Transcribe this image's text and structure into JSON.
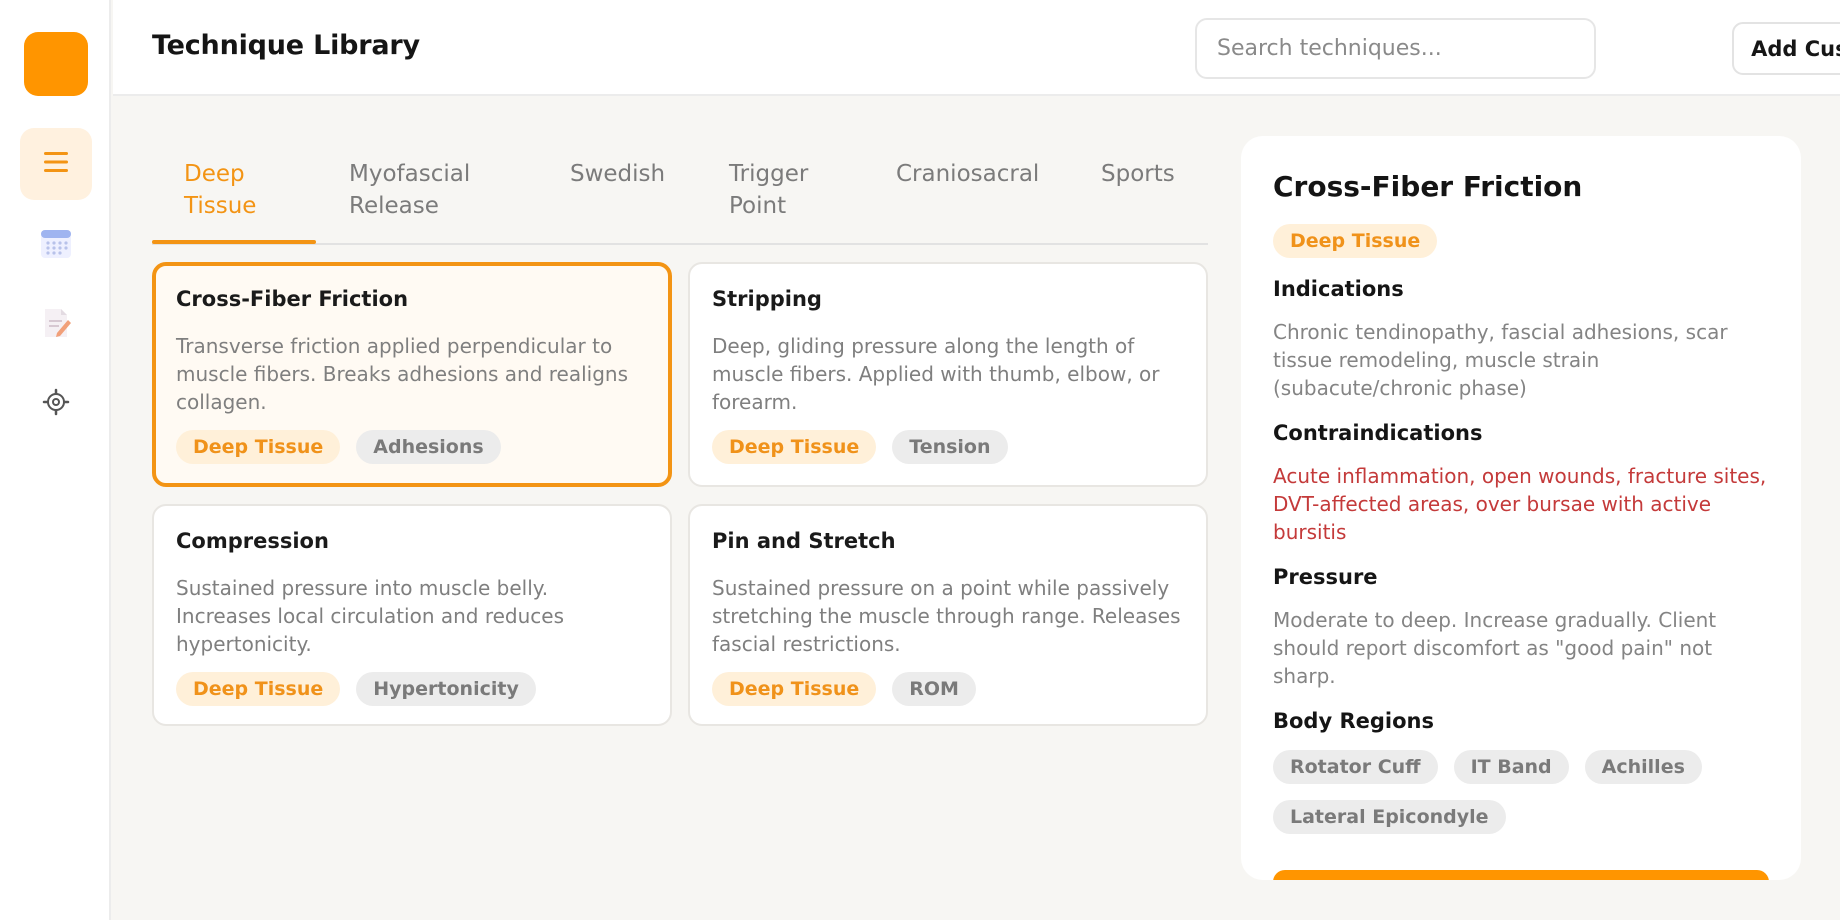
{
  "app": {
    "logo_color": "#ff9500",
    "accent": "#f39414"
  },
  "sidebar": {
    "items": [
      {
        "name": "menu",
        "icon": "menu-icon",
        "active": true
      },
      {
        "name": "calendar",
        "icon": "calendar-icon",
        "active": false
      },
      {
        "name": "notes",
        "icon": "notes-icon",
        "active": false
      },
      {
        "name": "settings",
        "icon": "gear-icon",
        "active": false
      }
    ]
  },
  "header": {
    "title": "Technique Library",
    "search_placeholder": "Search techniques...",
    "add_label": "Add Custom"
  },
  "tabs": [
    {
      "label": "Deep\nTissue",
      "active": true
    },
    {
      "label": "Myofascial\nRelease",
      "active": false
    },
    {
      "label": "Swedish",
      "active": false
    },
    {
      "label": "Trigger\nPoint",
      "active": false
    },
    {
      "label": "Craniosacral",
      "active": false
    },
    {
      "label": "Sports",
      "active": false
    }
  ],
  "cards": [
    {
      "title": "Cross-Fiber Friction",
      "desc": "Transverse friction applied perpendicular to muscle fibers. Breaks adhesions and realigns collagen.",
      "tags": [
        "Deep Tissue",
        "Adhesions"
      ],
      "selected": true
    },
    {
      "title": "Stripping",
      "desc": "Deep, gliding pressure along the length of muscle fibers. Applied with thumb, elbow, or forearm.",
      "tags": [
        "Deep Tissue",
        "Tension"
      ],
      "selected": false
    },
    {
      "title": "Compression",
      "desc": "Sustained pressure into muscle belly. Increases local circulation and reduces hypertonicity.",
      "tags": [
        "Deep Tissue",
        "Hypertonicity"
      ],
      "selected": false
    },
    {
      "title": "Pin and Stretch",
      "desc": "Sustained pressure on a point while passively stretching the muscle through range. Releases fascial restrictions.",
      "tags": [
        "Deep Tissue",
        "ROM"
      ],
      "selected": false
    }
  ],
  "detail": {
    "title": "Cross-Fiber Friction",
    "category": "Deep Tissue",
    "indications_label": "Indications",
    "indications": "Chronic tendinopathy, fascial adhesions, scar tissue remodeling, muscle strain (subacute/chronic phase)",
    "contra_label": "Contraindications",
    "contra": "Acute inflammation, open wounds, fracture sites, DVT-affected areas, over bursae with active bursitis",
    "pressure_label": "Pressure",
    "pressure": "Moderate to deep. Increase gradually. Client should report discomfort as \"good pain\" not sharp.",
    "regions_label": "Body Regions",
    "regions": [
      "Rotator Cuff",
      "IT Band",
      "Achilles",
      "Lateral Epicondyle"
    ],
    "danger_color": "#c43a3a"
  }
}
